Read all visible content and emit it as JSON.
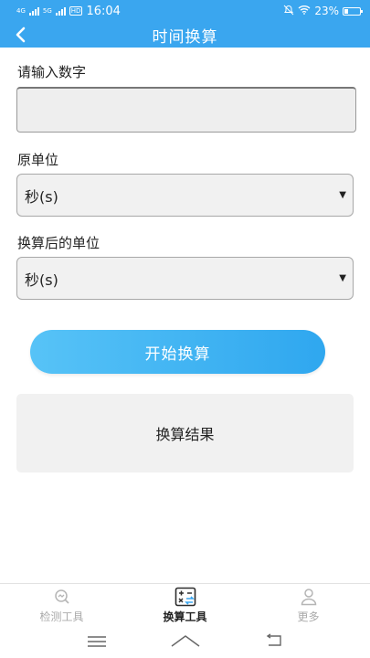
{
  "status_bar": {
    "network_1": "4G",
    "network_2": "5G",
    "hd_badge": "HD",
    "time": "16:04",
    "battery": "23%"
  },
  "app_bar": {
    "title": "时间换算",
    "back_icon": "chevron-left-icon"
  },
  "form": {
    "input_label": "请输入数字",
    "input_value": "",
    "source_unit_label": "原单位",
    "source_unit_value": "秒(s)",
    "target_unit_label": "换算后的单位",
    "target_unit_value": "秒(s)",
    "start_button": "开始换算",
    "result_text": "换算结果"
  },
  "bottom_nav": {
    "items": [
      {
        "label": "检测工具",
        "icon": "detect-icon",
        "active": false
      },
      {
        "label": "换算工具",
        "icon": "calculator-icon",
        "active": true
      },
      {
        "label": "更多",
        "icon": "user-icon",
        "active": false
      }
    ]
  },
  "colors": {
    "primary": "#3aa6ef",
    "button_gradient_start": "#57c3f7",
    "button_gradient_end": "#2fa7ef",
    "field_bg": "#f1f1f1"
  }
}
